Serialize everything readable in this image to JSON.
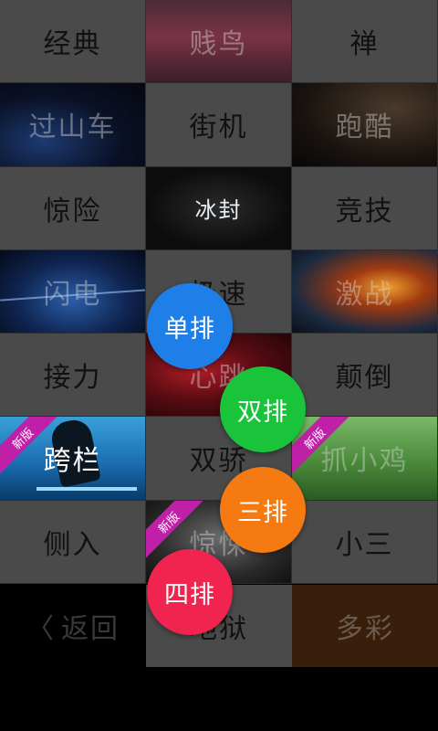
{
  "grid": {
    "r1c1": "经典",
    "r1c2": "贱鸟",
    "r1c3": "禅",
    "r2c1": "过山车",
    "r2c2": "街机",
    "r2c3": "跑酷",
    "r3c1": "惊险",
    "r3c2": "冰封",
    "r3c3": "竞技",
    "r4c1": "闪电",
    "r4c2": "极速",
    "r4c3": "激战",
    "r5c1": "接力",
    "r5c2": "心跳",
    "r5c3": "颠倒",
    "r6c1": "跨栏",
    "r6c2": "双骄",
    "r6c3": "抓小鸡",
    "r7c1": "侧入",
    "r7c2": "惊悚",
    "r7c3": "小三"
  },
  "ribbon": {
    "new_label": "新版"
  },
  "bottom": {
    "back_chevron": "〈",
    "back_label": "返回",
    "hell_label": "地狱",
    "colorful_label": "多彩"
  },
  "fab": {
    "single": "单排",
    "double": "双排",
    "triple": "三排",
    "quad": "四排"
  },
  "colors": {
    "tile_gray": "#4a4a4a",
    "single": "#1f7fe8",
    "double": "#19c33a",
    "triple": "#f57a12",
    "quad": "#f0244e",
    "ribbon": "#c01fa8"
  }
}
